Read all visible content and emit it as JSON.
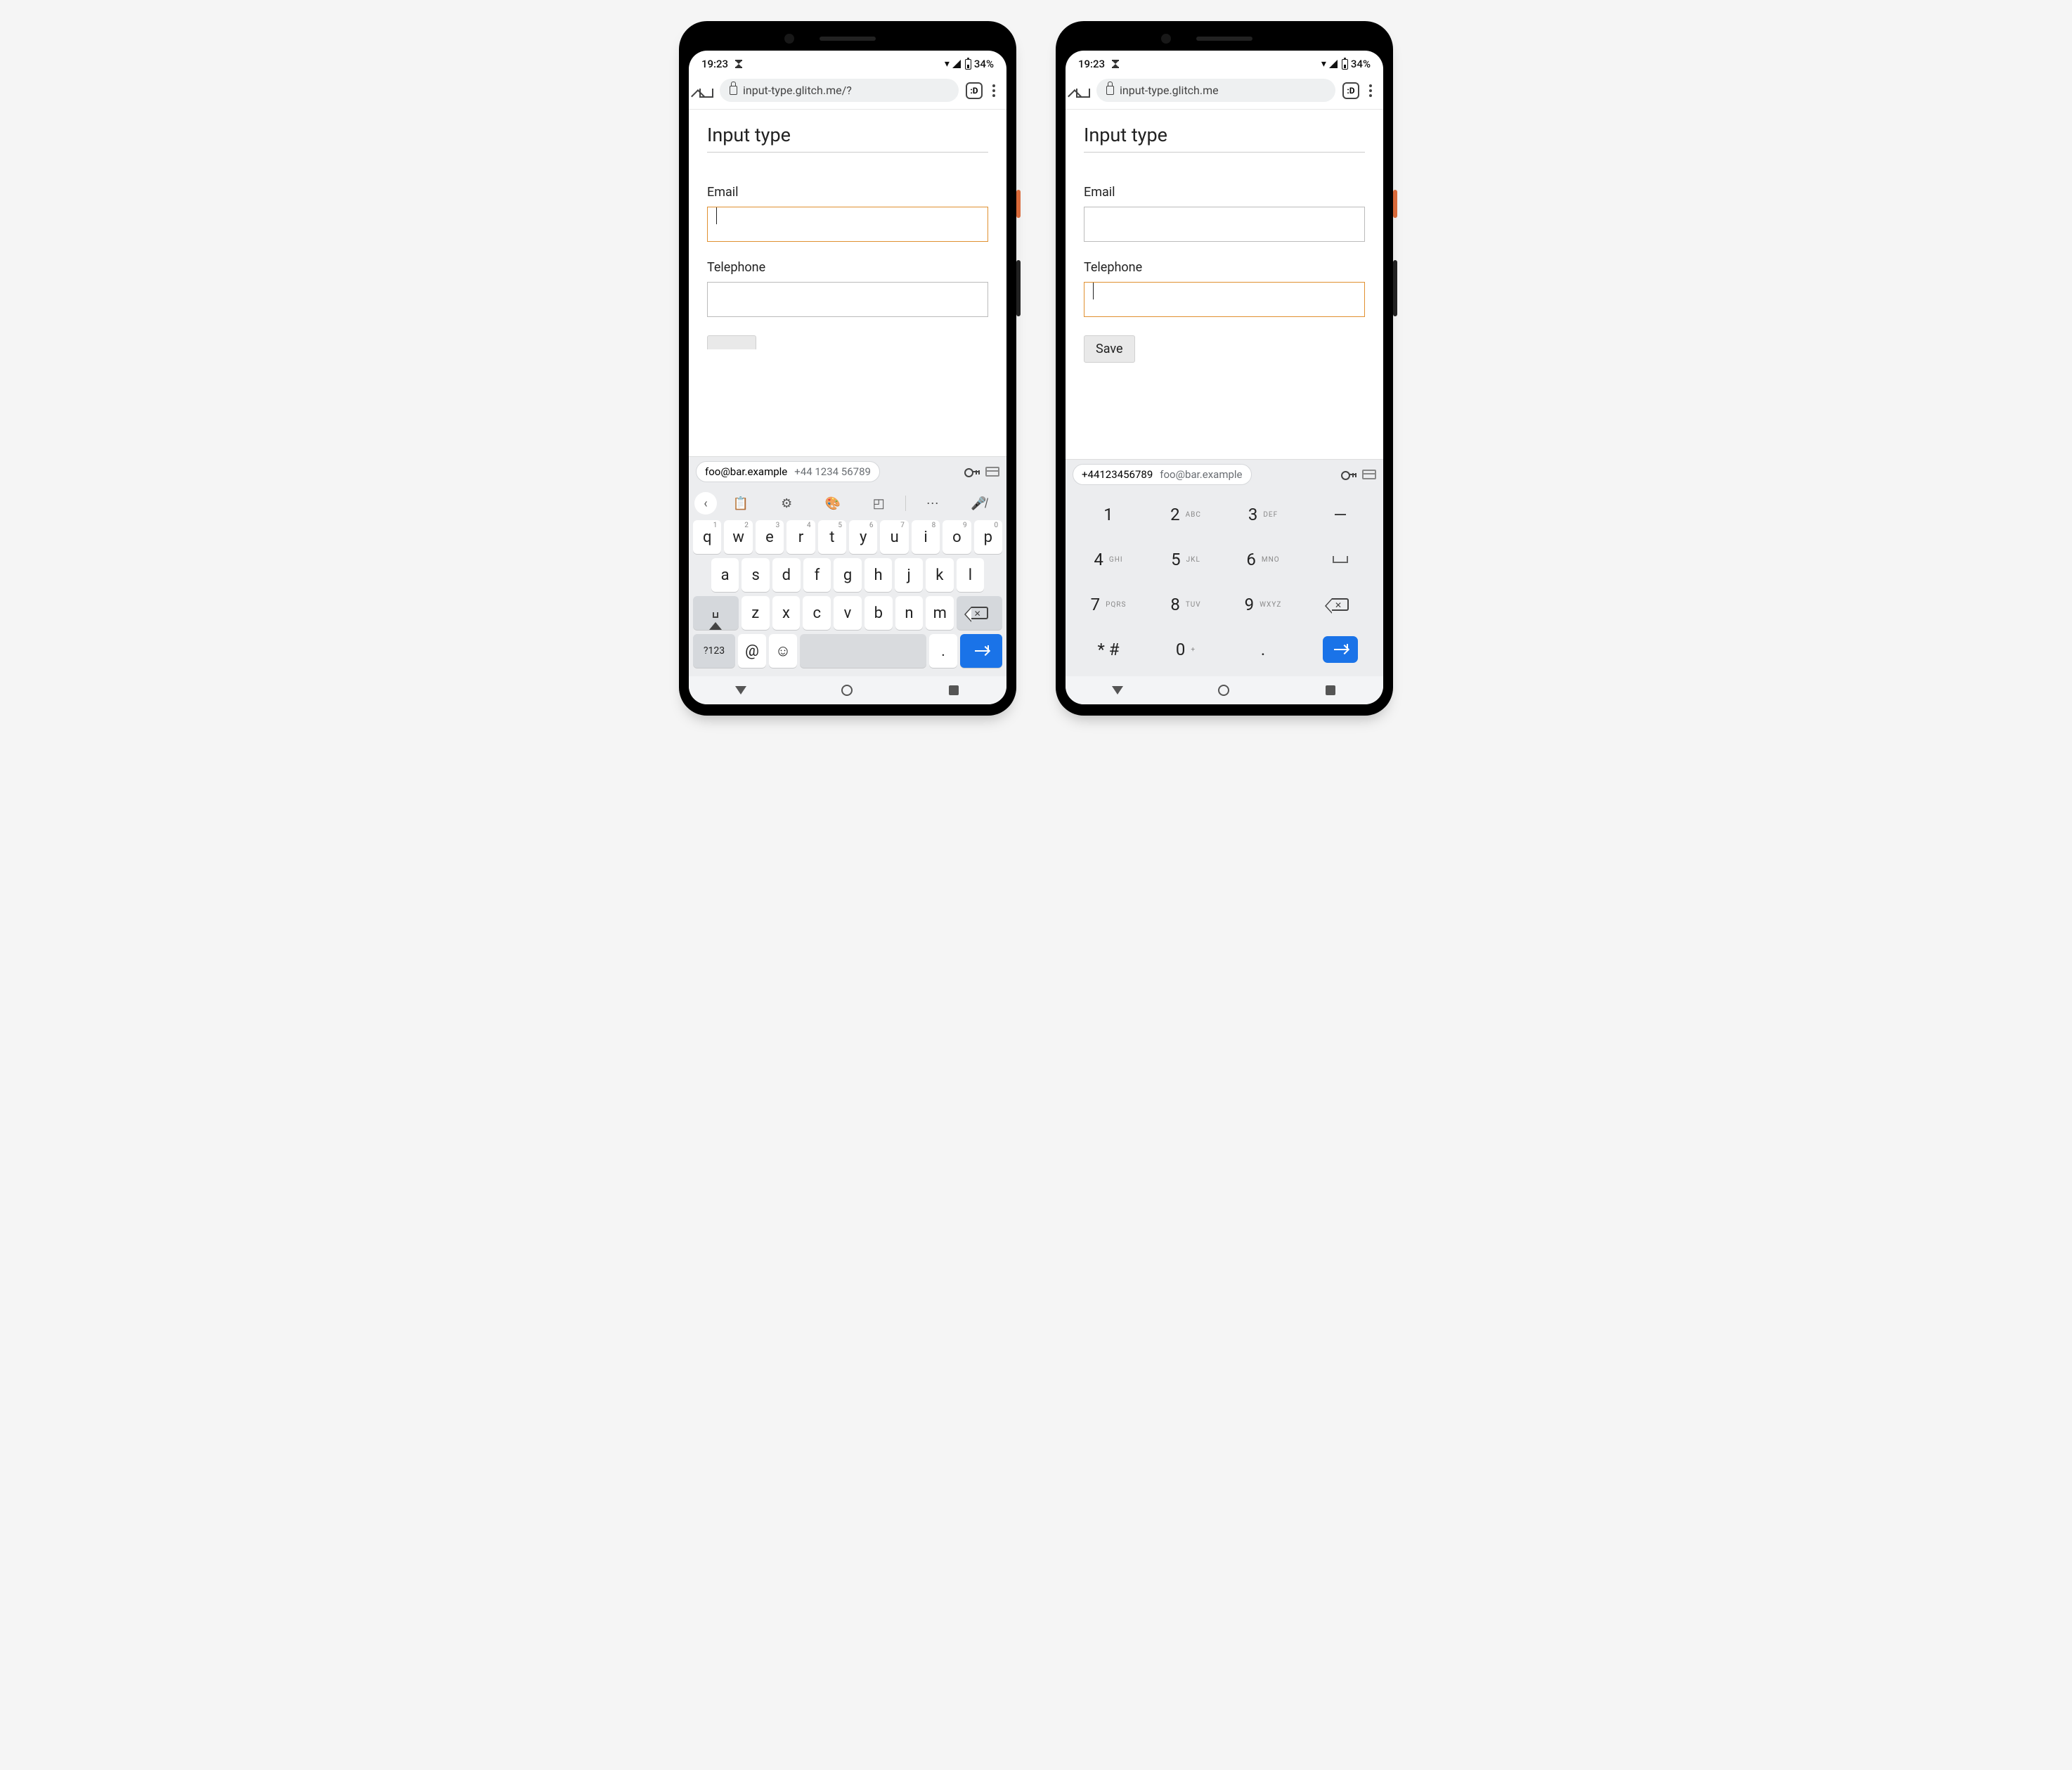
{
  "statusbar": {
    "time": "19:23",
    "battery": "34%"
  },
  "browser": {
    "url_a": "input-type.glitch.me/?",
    "url_b": "input-type.glitch.me",
    "tab_icon": ":D"
  },
  "page": {
    "title": "Input type",
    "email_label": "Email",
    "tel_label": "Telephone",
    "save_label": "Save"
  },
  "autofill": {
    "email": "foo@bar.example",
    "phone": "+44 1234 56789",
    "phone_compact": "+44123456789"
  },
  "qwerty": {
    "row1": [
      {
        "k": "q",
        "n": "1"
      },
      {
        "k": "w",
        "n": "2"
      },
      {
        "k": "e",
        "n": "3"
      },
      {
        "k": "r",
        "n": "4"
      },
      {
        "k": "t",
        "n": "5"
      },
      {
        "k": "y",
        "n": "6"
      },
      {
        "k": "u",
        "n": "7"
      },
      {
        "k": "i",
        "n": "8"
      },
      {
        "k": "o",
        "n": "9"
      },
      {
        "k": "p",
        "n": "0"
      }
    ],
    "row2": [
      "a",
      "s",
      "d",
      "f",
      "g",
      "h",
      "j",
      "k",
      "l"
    ],
    "row3": [
      "z",
      "x",
      "c",
      "v",
      "b",
      "n",
      "m"
    ],
    "sym": "?123",
    "at": "@",
    "period": "."
  },
  "numpad": {
    "rows": [
      [
        {
          "d": "1",
          "l": ""
        },
        {
          "d": "2",
          "l": "ABC"
        },
        {
          "d": "3",
          "l": "DEF"
        }
      ],
      [
        {
          "d": "4",
          "l": "GHI"
        },
        {
          "d": "5",
          "l": "JKL"
        },
        {
          "d": "6",
          "l": "MNO"
        }
      ],
      [
        {
          "d": "7",
          "l": "PQRS"
        },
        {
          "d": "8",
          "l": "TUV"
        },
        {
          "d": "9",
          "l": "WXYZ"
        }
      ],
      [
        {
          "d": "* #",
          "l": ""
        },
        {
          "d": "0",
          "l": "+"
        },
        {
          "d": ".",
          "l": ""
        }
      ]
    ]
  }
}
